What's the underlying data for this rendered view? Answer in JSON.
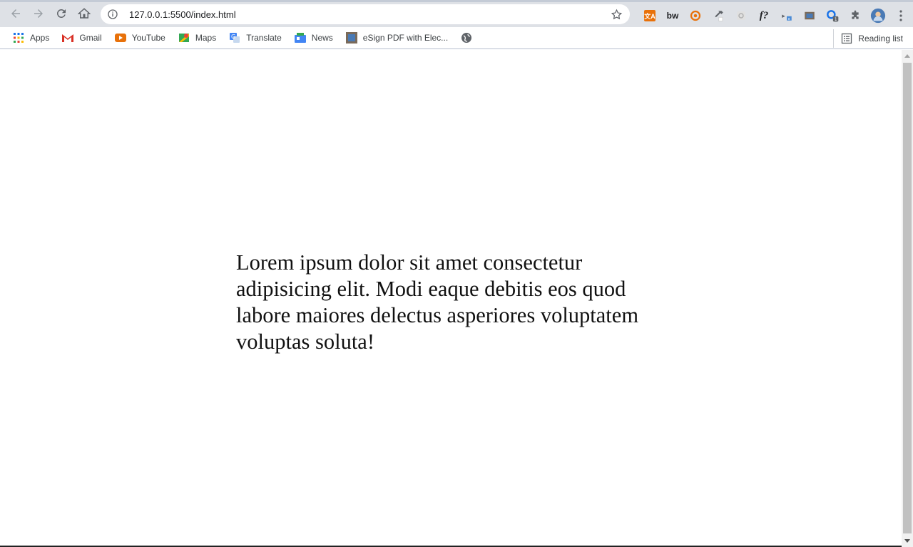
{
  "browser": {
    "url": "127.0.0.1:5500/index.html",
    "nav": {
      "back_icon": "arrow-left-icon",
      "forward_icon": "arrow-right-icon",
      "reload_icon": "reload-icon",
      "home_icon": "home-icon"
    },
    "extensions": [
      {
        "name": "extension-translate",
        "label": "文A",
        "color": "#e8710a"
      },
      {
        "name": "extension-bw",
        "label": "bw",
        "color": "#202124"
      },
      {
        "name": "extension-eye",
        "label": "",
        "color": "#e8710a"
      },
      {
        "name": "extension-eyedropper",
        "label": "",
        "color": "#5f6368"
      },
      {
        "name": "extension-gear-grey",
        "label": "",
        "color": "#c0c0c0"
      },
      {
        "name": "extension-fx",
        "label": "f?",
        "color": "#202124"
      },
      {
        "name": "extension-cast",
        "label": "",
        "color": "#5f6368"
      },
      {
        "name": "extension-esign",
        "label": "",
        "color": "#7a6a5a"
      },
      {
        "name": "extension-counter",
        "label": "1",
        "color": "#1a73e8"
      },
      {
        "name": "extension-puzzle",
        "label": "",
        "color": "#5f6368"
      },
      {
        "name": "profile-avatar",
        "label": "",
        "color": "#4a7ab5"
      },
      {
        "name": "menu-kebab",
        "label": "⋮",
        "color": "#5f6368"
      }
    ]
  },
  "bookmarks": [
    {
      "label": "Apps",
      "icon": "apps-grid-icon",
      "color": "#5f6368"
    },
    {
      "label": "Gmail",
      "icon": "gmail-icon",
      "color": "#d93025"
    },
    {
      "label": "YouTube",
      "icon": "youtube-icon",
      "color": "#e8710a"
    },
    {
      "label": "Maps",
      "icon": "maps-icon",
      "color": "#1e8e3e"
    },
    {
      "label": "Translate",
      "icon": "translate-icon",
      "color": "#4285f4"
    },
    {
      "label": "News",
      "icon": "news-icon",
      "color": "#4285f4"
    },
    {
      "label": "eSign PDF with Elec...",
      "icon": "esign-icon",
      "color": "#7a6a5a"
    },
    {
      "label": "",
      "icon": "globe-icon",
      "color": "#5f6368"
    }
  ],
  "reading_list": {
    "label": "Reading list",
    "icon": "reading-list-icon"
  },
  "page": {
    "text": "Lorem ipsum dolor sit amet consectetur adipisicing elit. Modi eaque debitis eos quod labore maiores delectus asperiores voluptatem voluptas soluta!"
  }
}
